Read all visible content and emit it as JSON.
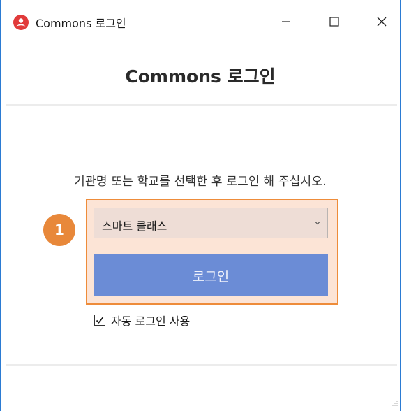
{
  "window": {
    "title": "Commons 로그인",
    "icon": "commons-logo-icon",
    "controls": [
      "minimize-icon",
      "maximize-icon",
      "close-icon"
    ]
  },
  "header": {
    "title": "Commons 로그인"
  },
  "instruction": "기관명 또는 학교를 선택한 후 로그인 해 주십시오.",
  "institution_select": {
    "selected": "스마트 클래스"
  },
  "login_button": {
    "label": "로그인"
  },
  "auto_login": {
    "label": "자동 로그인 사용",
    "checked": true
  },
  "annotation": {
    "marker": "1"
  },
  "colors": {
    "highlight_border": "#ee8c3a",
    "highlight_fill": "#fce4d6",
    "login_button": "#6b8cd6",
    "marker": "#e8883a",
    "app_icon": "#e13a3a",
    "window_border": "#2b7bd3"
  }
}
